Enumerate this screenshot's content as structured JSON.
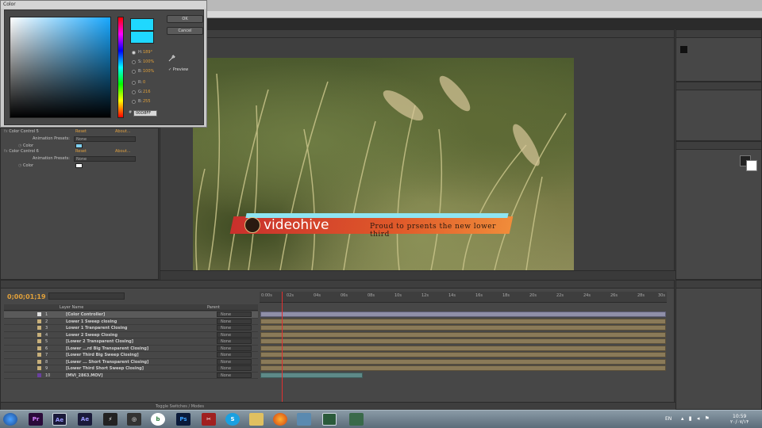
{
  "color_dialog": {
    "title": "Color",
    "ok_label": "OK",
    "cancel_label": "Cancel",
    "preview_label": "Preview",
    "selected_color": "#1fd8ff",
    "hsb_rgb": [
      {
        "label": "H:",
        "value": "189°"
      },
      {
        "label": "S:",
        "value": "100%"
      },
      {
        "label": "B:",
        "value": "100%"
      },
      {
        "label": "R:",
        "value": "0"
      },
      {
        "label": "G:",
        "value": "216"
      },
      {
        "label": "B:",
        "value": "255"
      }
    ],
    "hex_value": "00D8FF"
  },
  "effects": {
    "controls": [
      {
        "name": "Color Control 5",
        "reset": "Reset",
        "about": "About...",
        "presets_label": "Animation Presets:",
        "preset_value": "None",
        "prop_label": "Color",
        "color": "#7fd0f0"
      },
      {
        "name": "Color Control 6",
        "reset": "Reset",
        "about": "About...",
        "presets_label": "Animation Presets:",
        "preset_value": "None",
        "prop_label": "Color",
        "color": "#ffffff"
      }
    ]
  },
  "comp": {
    "lower_third_brand": "videohive",
    "lower_third_tagline": "Proud to prsents the new lower third"
  },
  "timeline": {
    "timecode": "0;00;01;19",
    "col_name_label": "Layer Name",
    "col_parent_label": "Parent",
    "footer_label": "Toggle Switches / Modes",
    "tick_labels": [
      "0:00s",
      "02s",
      "04s",
      "06s",
      "08s",
      "10s",
      "12s",
      "14s",
      "16s",
      "18s",
      "20s",
      "22s",
      "24s",
      "26s",
      "28s",
      "30s"
    ],
    "layers": [
      {
        "num": "1",
        "name": "[Color Controller]",
        "parent": "None",
        "chip": "#e0e0e0"
      },
      {
        "num": "2",
        "name": "Lower 1 Sweep closing",
        "parent": "None",
        "chip": "#c8b07a"
      },
      {
        "num": "3",
        "name": "Lower 1 Tranparent Closing",
        "parent": "None",
        "chip": "#c8b07a"
      },
      {
        "num": "4",
        "name": "Lower 2 Sweep Closing",
        "parent": "None",
        "chip": "#c8b07a"
      },
      {
        "num": "5",
        "name": "[Lower 2 Transparent Closing]",
        "parent": "None",
        "chip": "#c8b07a"
      },
      {
        "num": "6",
        "name": "[Lower ...rd Big Transparent Closing]",
        "parent": "None",
        "chip": "#c8b07a"
      },
      {
        "num": "7",
        "name": "[Lower Third Big Sweep Closing]",
        "parent": "None",
        "chip": "#c8b07a"
      },
      {
        "num": "8",
        "name": "[Lower ... Short Transparent Closing]",
        "parent": "None",
        "chip": "#c8b07a"
      },
      {
        "num": "9",
        "name": "[Lower Third Short Sweep Closing]",
        "parent": "None",
        "chip": "#c8b07a"
      },
      {
        "num": "10",
        "name": "[MVI_2863.MOV]",
        "parent": "None",
        "chip": "#6a3fa0"
      }
    ]
  },
  "taskbar": {
    "lang": "EN",
    "time": "10:59",
    "date": "۲۰/۰۷/۱۴"
  }
}
